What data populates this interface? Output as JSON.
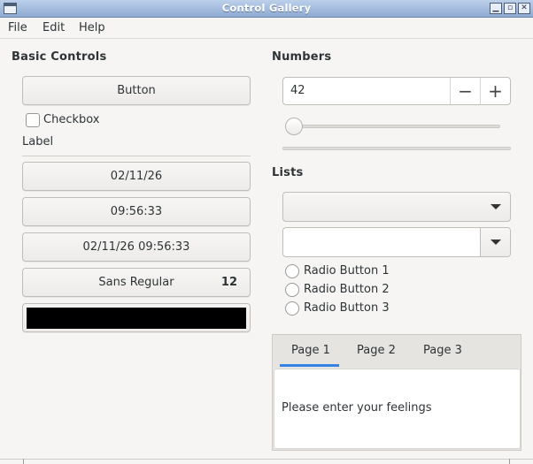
{
  "window": {
    "title": "Control Gallery",
    "controls": [
      "minimize-icon",
      "maximize-icon",
      "close-icon"
    ]
  },
  "menu": {
    "items": [
      "File",
      "Edit",
      "Help"
    ]
  },
  "basic": {
    "heading": "Basic Controls",
    "button_label": "Button",
    "checkbox_label": "Checkbox",
    "checkbox_checked": false,
    "label": "Label",
    "date_label": "02/11/26",
    "time_label": "09:56:33",
    "datetime_label": "02/11/26 09:56:33",
    "font_name": "Sans Regular",
    "font_size": "12",
    "color_value": "#000000"
  },
  "numbers": {
    "heading": "Numbers",
    "spin_value": "42",
    "spin_minus": "−",
    "spin_plus": "+",
    "slider_value": 0,
    "progress_value": 0
  },
  "lists": {
    "heading": "Lists",
    "combo_value": "",
    "editable_combo_value": "",
    "radios": [
      "Radio Button 1",
      "Radio Button 2",
      "Radio Button 3"
    ]
  },
  "tabs": {
    "items": [
      "Page 1",
      "Page 2",
      "Page 3"
    ],
    "selected": 0,
    "page_text": "Please enter your feelings",
    "accent_color": "#3584e4"
  }
}
